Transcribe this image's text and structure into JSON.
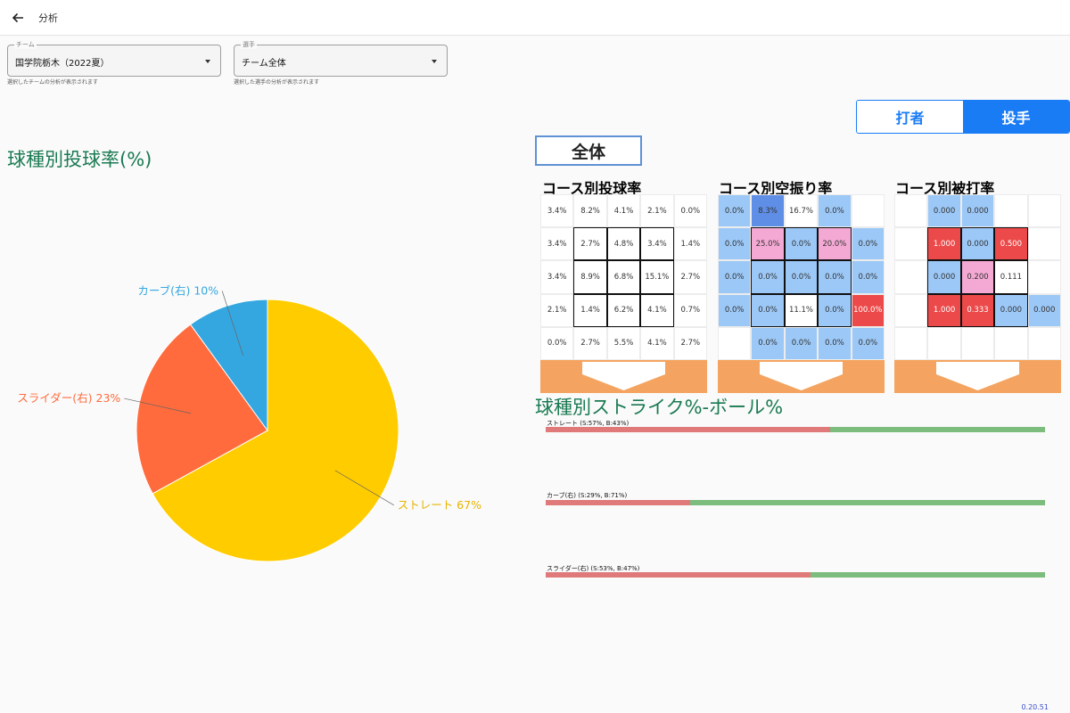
{
  "appbar": {
    "title": "分析"
  },
  "filters": {
    "team": {
      "legend": "チーム",
      "value": "国学院栃木（2022夏）",
      "help": "選択したチームの分析が表示されます"
    },
    "player": {
      "legend": "選手",
      "value": "チーム全体",
      "help": "選択した選手の分析が表示されます"
    }
  },
  "toggle": {
    "batter": "打者",
    "pitcher": "投手",
    "selected": "投手"
  },
  "pie_section": {
    "title": "球種別投球率(%)"
  },
  "chart_data": [
    {
      "type": "pie",
      "title": "球種別投球率(%)",
      "slices": [
        {
          "label": "ストレート 67%",
          "value": 67,
          "color": "#ffcc00"
        },
        {
          "label": "スライダー(右) 23%",
          "value": 23,
          "color": "#ff6b3d"
        },
        {
          "label": "カーブ(右) 10%",
          "value": 10,
          "color": "#35a7e0"
        }
      ]
    },
    {
      "type": "bar",
      "title": "球種別ストライク%-ボール%",
      "categories": [
        "ストレート (S:57%, B:43%)",
        "カーブ(右) (S:29%, B:71%)",
        "スライダー(右) (S:53%, B:47%)"
      ],
      "series": [
        {
          "name": "S",
          "values": [
            57,
            29,
            53
          ],
          "color": "#e07a7a"
        },
        {
          "name": "B",
          "values": [
            43,
            71,
            47
          ],
          "color": "#7cbc7c"
        }
      ]
    }
  ],
  "zone_section": {
    "overall_label": "全体",
    "panels": [
      {
        "title": "コース別投球率",
        "cells": [
          [
            [
              "3.4%",
              "w"
            ],
            [
              "8.2%",
              "w"
            ],
            [
              "4.1%",
              "w"
            ],
            [
              "2.1%",
              "w"
            ],
            [
              "0.0%",
              "w"
            ]
          ],
          [
            [
              "3.4%",
              "w"
            ],
            [
              "2.7%",
              "w"
            ],
            [
              "4.8%",
              "w"
            ],
            [
              "3.4%",
              "w"
            ],
            [
              "1.4%",
              "w"
            ]
          ],
          [
            [
              "3.4%",
              "w"
            ],
            [
              "8.9%",
              "w"
            ],
            [
              "6.8%",
              "w"
            ],
            [
              "15.1%",
              "w"
            ],
            [
              "2.7%",
              "w"
            ]
          ],
          [
            [
              "2.1%",
              "w"
            ],
            [
              "1.4%",
              "w"
            ],
            [
              "6.2%",
              "w"
            ],
            [
              "4.1%",
              "w"
            ],
            [
              "0.7%",
              "w"
            ]
          ],
          [
            [
              "0.0%",
              "w"
            ],
            [
              "2.7%",
              "w"
            ],
            [
              "5.5%",
              "w"
            ],
            [
              "4.1%",
              "w"
            ],
            [
              "2.7%",
              "w"
            ]
          ]
        ]
      },
      {
        "title": "コース別空振り率",
        "cells": [
          [
            [
              "0.0%",
              "lb"
            ],
            [
              "8.3%",
              "mb"
            ],
            [
              "16.7%",
              "w"
            ],
            [
              "0.0%",
              "lb"
            ],
            [
              "",
              "w"
            ]
          ],
          [
            [
              "0.0%",
              "lb"
            ],
            [
              "25.0%",
              "pk"
            ],
            [
              "0.0%",
              "lb"
            ],
            [
              "20.0%",
              "pk"
            ],
            [
              "0.0%",
              "lb"
            ]
          ],
          [
            [
              "0.0%",
              "lb"
            ],
            [
              "0.0%",
              "lb"
            ],
            [
              "0.0%",
              "lb"
            ],
            [
              "0.0%",
              "lb"
            ],
            [
              "0.0%",
              "lb"
            ]
          ],
          [
            [
              "0.0%",
              "lb"
            ],
            [
              "0.0%",
              "lb"
            ],
            [
              "11.1%",
              "w"
            ],
            [
              "0.0%",
              "lb"
            ],
            [
              "100.0%",
              "rd"
            ]
          ],
          [
            [
              "",
              "w"
            ],
            [
              "0.0%",
              "lb"
            ],
            [
              "0.0%",
              "lb"
            ],
            [
              "0.0%",
              "lb"
            ],
            [
              "0.0%",
              "lb"
            ]
          ]
        ]
      },
      {
        "title": "コース別被打率",
        "cells": [
          [
            [
              "",
              "w"
            ],
            [
              "0.000",
              "lb"
            ],
            [
              "0.000",
              "lb"
            ],
            [
              "",
              "w"
            ],
            [
              "",
              "w"
            ]
          ],
          [
            [
              "",
              "w"
            ],
            [
              "1.000",
              "rd"
            ],
            [
              "0.000",
              "lb"
            ],
            [
              "0.500",
              "rd"
            ],
            [
              "",
              "w"
            ]
          ],
          [
            [
              "",
              "w"
            ],
            [
              "0.000",
              "lb"
            ],
            [
              "0.200",
              "pk"
            ],
            [
              "0.111",
              "w"
            ],
            [
              "",
              "w"
            ]
          ],
          [
            [
              "",
              "w"
            ],
            [
              "1.000",
              "rd"
            ],
            [
              "0.333",
              "rd"
            ],
            [
              "0.000",
              "lb"
            ],
            [
              "0.000",
              "lb"
            ]
          ],
          [
            [
              "",
              "w"
            ],
            [
              "",
              "w"
            ],
            [
              "",
              "w"
            ],
            [
              "",
              "w"
            ],
            [
              "",
              "w"
            ]
          ]
        ]
      }
    ],
    "colors": {
      "w": "#ffffff",
      "lb": "#9cc8f7",
      "mb": "#5f8ee6",
      "pk": "#f4a9d4",
      "rd": "#ec4a4a"
    }
  },
  "strike_section": {
    "title": "球種別ストライク%-ボール%"
  },
  "version": "0.20.51"
}
